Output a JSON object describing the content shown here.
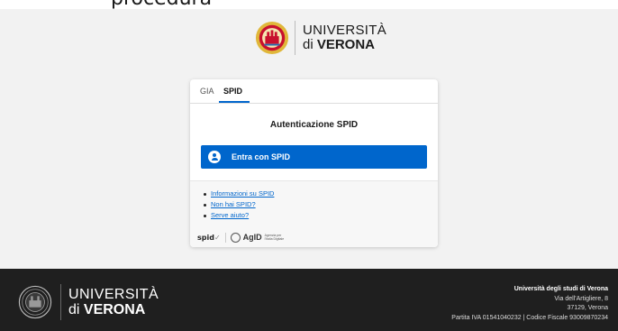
{
  "top_strip": {
    "partial_text": "procedura"
  },
  "header": {
    "logo": {
      "line1": "UNIVERSITÀ",
      "line2_prefix": "di ",
      "line2_bold": "VERONA"
    }
  },
  "login_card": {
    "tabs": [
      {
        "label": "GIA",
        "active": false
      },
      {
        "label": "SPID",
        "active": true
      }
    ],
    "title": "Autenticazione SPID",
    "spid_button": {
      "label": "Entra con SPID",
      "icon": "user-icon"
    },
    "links": [
      "Informazioni su SPID",
      "Non hai SPID?",
      "Serve aiuto?"
    ],
    "partner_logos": {
      "spid": "spid",
      "spid_mark": "✓",
      "agid": "AgID",
      "agid_caption": "Agenzia per l'Italia Digitale"
    }
  },
  "footer": {
    "logo": {
      "line1": "UNIVERSITÀ",
      "line2_prefix": "di ",
      "line2_bold": "VERONA"
    },
    "info": {
      "name": "Università degli studi di Verona",
      "address1": "Via dell'Artigliere, 8",
      "address2": "37129, Verona",
      "fiscal": "Partita IVA 01541040232 | Codice Fiscale 93009870234"
    }
  },
  "colors": {
    "primary": "#0066cc",
    "footer_bg": "#1f1f1f",
    "page_bg": "#f2f2f2",
    "seal_red": "#c8102e",
    "seal_gold": "#e0b73a"
  }
}
